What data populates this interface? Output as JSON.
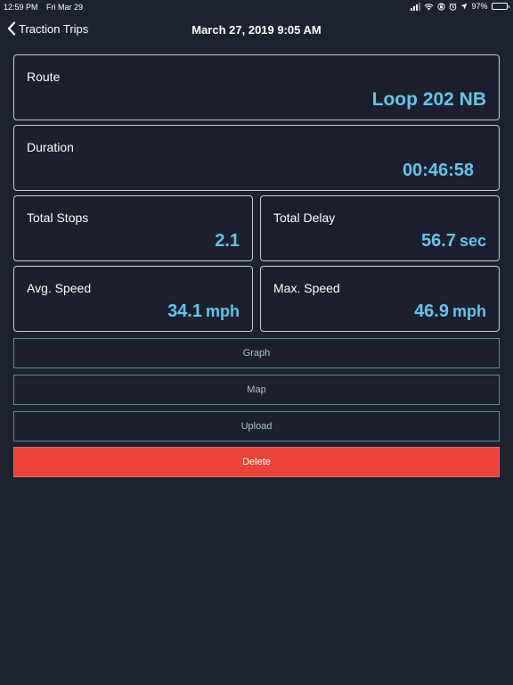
{
  "status_bar": {
    "time": "12:59 PM",
    "date": "Fri Mar 29",
    "battery": "97%",
    "battery_level": 0.97
  },
  "nav": {
    "back_label": "Traction Trips",
    "title": "March 27, 2019 9:05 AM"
  },
  "cards": {
    "route": {
      "label": "Route",
      "value": "Loop 202 NB"
    },
    "duration": {
      "label": "Duration",
      "value": "00:46:58"
    },
    "total_stops": {
      "label": "Total Stops",
      "value": "2.1"
    },
    "total_delay": {
      "label": "Total Delay",
      "value": "56.7",
      "unit": "sec"
    },
    "avg_speed": {
      "label": "Avg. Speed",
      "value": "34.1",
      "unit": "mph"
    },
    "max_speed": {
      "label": "Max. Speed",
      "value": "46.9",
      "unit": "mph"
    }
  },
  "actions": {
    "graph": "Graph",
    "map": "Map",
    "upload": "Upload",
    "delete": "Delete"
  },
  "colors": {
    "background": "#1d2231",
    "accent_value": "#5fc8e6",
    "delete": "#eb4238",
    "button_border": "#5d8c98"
  },
  "icons": {
    "back": "chevron-left-icon",
    "wifi": "wifi-icon",
    "lock_rotation": "rotation-lock-icon",
    "alarm": "alarm-icon",
    "location": "location-arrow-icon",
    "battery": "battery-icon",
    "signal": "signal-icon"
  }
}
